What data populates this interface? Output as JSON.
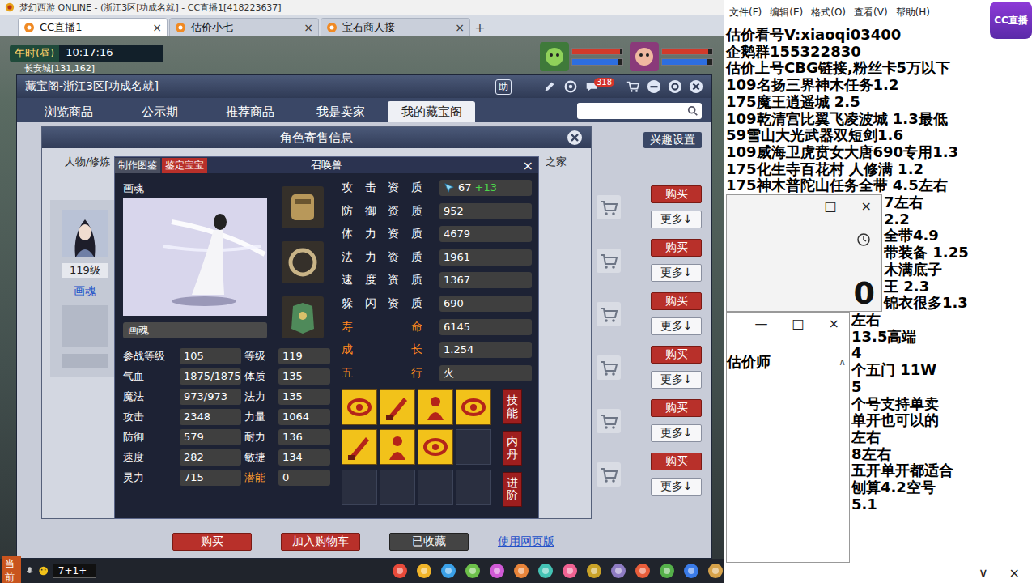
{
  "app_window": {
    "title": "梦幻西游 ONLINE - (浙江3区[功成名就] - CC直播1[418223637]"
  },
  "browser_tabs": [
    {
      "label": "CC直播1",
      "close": "×",
      "selected": true
    },
    {
      "label": "估价小七",
      "close": "×",
      "selected": false
    },
    {
      "label": "宝石商人接",
      "close": "×",
      "selected": false
    }
  ],
  "new_tab": "+",
  "hud": {
    "period": "午时(昼)",
    "clock": "10:17:16",
    "location": "长安城[131,162]"
  },
  "party": [
    {
      "bars": [
        {
          "level": 0.95,
          "color": "#d23a2a"
        },
        {
          "level": 0.9,
          "color": "#2d6ee0"
        }
      ]
    },
    {
      "bars": [
        {
          "level": 0.92,
          "color": "#d23a2a"
        },
        {
          "level": 0.88,
          "color": "#2d6ee0"
        }
      ]
    }
  ],
  "chat_bar": {
    "channel": "当前",
    "input": "7+1+"
  },
  "cbg": {
    "title": "藏宝阁-浙江3区[功成名就]",
    "help": "助",
    "message_count": "318",
    "nav": [
      {
        "label": "浏览商品",
        "selected": false
      },
      {
        "label": "公示期",
        "selected": false
      },
      {
        "label": "推荐商品",
        "selected": false
      },
      {
        "label": "我是卖家",
        "selected": false
      },
      {
        "label": "我的藏宝阁",
        "selected": true
      }
    ],
    "interest_button": "兴趣设置",
    "listings": [
      {
        "buy": "购买",
        "more": "更多↓"
      },
      {
        "buy": "购买",
        "more": "更多↓"
      },
      {
        "buy": "购买",
        "more": "更多↓"
      },
      {
        "buy": "购买",
        "more": "更多↓"
      },
      {
        "buy": "购买",
        "more": "更多↓"
      },
      {
        "buy": "购买",
        "more": "更多↓"
      }
    ],
    "footer": {
      "buy": "购买",
      "add_cart": "加入购物车",
      "favorited": "已收藏",
      "web": "使用网页版"
    }
  },
  "consign": {
    "title": "角色寄售信息",
    "subtabs": [
      "人物/修炼",
      "之家"
    ],
    "role": {
      "level": "119级",
      "name": "画魂"
    }
  },
  "pet": {
    "tabs": [
      {
        "label": "制作图鉴",
        "selected": false
      },
      {
        "label": "鉴定宝宝",
        "selected": true
      }
    ],
    "title": "召唤兽",
    "close": "×",
    "portrait_label": "画魂",
    "name": "画魂",
    "stats": [
      {
        "label": "参战等级",
        "value": "105",
        "color": "#ffffff"
      },
      {
        "label": "等级",
        "value": "119",
        "color": "#ffffff"
      },
      {
        "label": "气血",
        "value": "1875/1875",
        "color": "#ffffff"
      },
      {
        "label": "体质",
        "value": "135",
        "color": "#ffffff"
      },
      {
        "label": "魔法",
        "value": "973/973",
        "color": "#ffffff"
      },
      {
        "label": "法力",
        "value": "135",
        "color": "#ffffff"
      },
      {
        "label": "攻击",
        "value": "2348",
        "color": "#ffffff"
      },
      {
        "label": "力量",
        "value": "1064",
        "color": "#ffffff"
      },
      {
        "label": "防御",
        "value": "579",
        "color": "#ffffff"
      },
      {
        "label": "耐力",
        "value": "136",
        "color": "#ffffff"
      },
      {
        "label": "速度",
        "value": "282",
        "color": "#ffffff"
      },
      {
        "label": "敏捷",
        "value": "134",
        "color": "#ffffff"
      },
      {
        "label": "灵力",
        "value": "715",
        "color": "#ffffff"
      },
      {
        "label": "潜能",
        "value": "0",
        "color": "#ff9a2e"
      }
    ],
    "aptitudes": [
      {
        "label": "攻击资质",
        "value": "67",
        "bonus": "+13",
        "color": "#ffffff"
      },
      {
        "label": "防御资质",
        "value": "952",
        "bonus": "",
        "color": "#ffffff"
      },
      {
        "label": "体力资质",
        "value": "4679",
        "bonus": "",
        "color": "#ffffff"
      },
      {
        "label": "法力资质",
        "value": "1961",
        "bonus": "",
        "color": "#ffffff"
      },
      {
        "label": "速度资质",
        "value": "1367",
        "bonus": "",
        "color": "#ffffff"
      },
      {
        "label": "躲闪资质",
        "value": "690",
        "bonus": "",
        "color": "#ffffff"
      },
      {
        "label": "寿命",
        "value": "6145",
        "bonus": "",
        "color": "#ff8a1e"
      },
      {
        "label": "成长",
        "value": "1.254",
        "bonus": "",
        "color": "#ff8a1e"
      },
      {
        "label": "五行",
        "value": "火",
        "bonus": "",
        "color": "#ff8a1e"
      }
    ],
    "skills": [
      {
        "filled": true
      },
      {
        "filled": true
      },
      {
        "filled": true
      },
      {
        "filled": true
      },
      {
        "filled": true
      },
      {
        "filled": true
      },
      {
        "filled": true
      },
      {
        "filled": false
      },
      {
        "filled": false
      },
      {
        "filled": false
      },
      {
        "filled": false
      },
      {
        "filled": false
      }
    ],
    "side_buttons": [
      "技能",
      "内丹",
      "进阶"
    ]
  },
  "notepad": {
    "menu": [
      "文件(F)",
      "编辑(E)",
      "格式(O)",
      "查看(V)",
      "帮助(H)"
    ],
    "lines": [
      "估价看号V:xiaoqi03400",
      "企鹅群155322830",
      "估价上号CBG链接,粉丝卡5万以下",
      "109名扬三界神木任务1.2",
      "175魔王逍遥城 2.5",
      "109乾清宫比翼飞凌波城 1.3最低",
      "59雪山大光武器双短剑1.6",
      "109威海卫虎贲女大唐690专用1.3",
      "175化生寺百花村 人修满 1.2",
      "175神木普陀山任务全带 4.5左右"
    ],
    "cut_lines_upper": [
      "7左右",
      "2.2",
      "全带4.9",
      "带装备 1.25",
      "木满底子",
      "王 2.3",
      "锦衣很多1.3"
    ],
    "cut_lines_lower": [
      "左右",
      "13.5高端",
      "4",
      "个五门 11W",
      "5",
      "个号支持单卖",
      "单开也可以的",
      "左右",
      "8左右",
      "五开单开都适合",
      "刨算4.2空号",
      "5.1"
    ],
    "bottom_buttons": [
      "∨",
      "×"
    ]
  },
  "calc_window": {
    "buttons": [
      "□",
      "×"
    ],
    "display": "0"
  },
  "appraiser_window": {
    "buttons": [
      "—",
      "□",
      "×"
    ],
    "text": "估价师",
    "scroll": "∧"
  },
  "cc_logo": "CC直播"
}
